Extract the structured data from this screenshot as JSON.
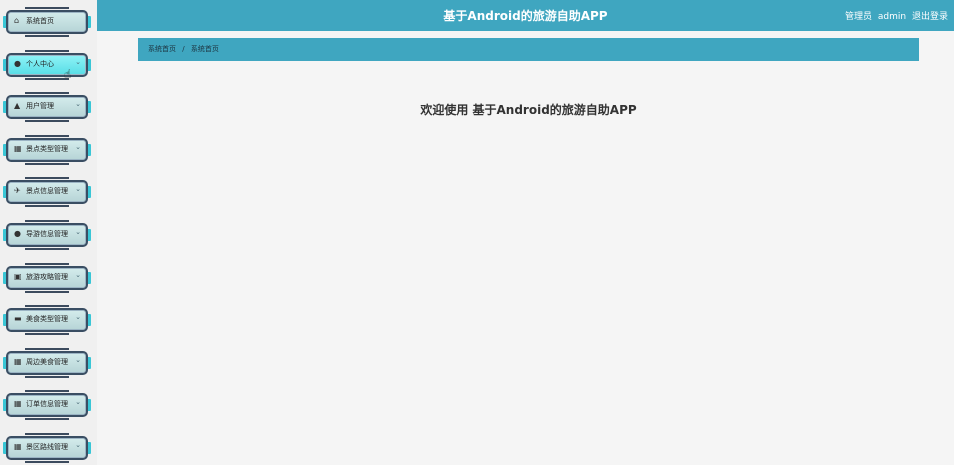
{
  "header": {
    "title": "基于Android的旅游自助APP",
    "user_role": "管理员",
    "username": "admin",
    "logout": "退出登录"
  },
  "sidebar": {
    "items": [
      {
        "label": "系统首页",
        "icon": "home-icon"
      },
      {
        "label": "个人中心",
        "icon": "person-icon"
      },
      {
        "label": "用户管理",
        "icon": "users-icon"
      },
      {
        "label": "景点类型管理",
        "icon": "grid-icon"
      },
      {
        "label": "景点信息管理",
        "icon": "plane-icon"
      },
      {
        "label": "导游信息管理",
        "icon": "person-icon"
      },
      {
        "label": "旅游攻略管理",
        "icon": "calendar-icon"
      },
      {
        "label": "美食类型管理",
        "icon": "chat-icon"
      },
      {
        "label": "周边美食管理",
        "icon": "grid-icon"
      },
      {
        "label": "订单信息管理",
        "icon": "grid-icon"
      },
      {
        "label": "景区路线管理",
        "icon": "grid-icon"
      }
    ],
    "active_index": 1
  },
  "breadcrumb": {
    "items": [
      "系统首页",
      "系统首页"
    ],
    "separator": "/"
  },
  "welcome": {
    "text": "欢迎使用 基于Android的旅游自助APP"
  },
  "colors": {
    "topbar": "#3fa6c0",
    "breadcrumb": "#3fa6c0",
    "active_menu": "#5ce3eb"
  }
}
